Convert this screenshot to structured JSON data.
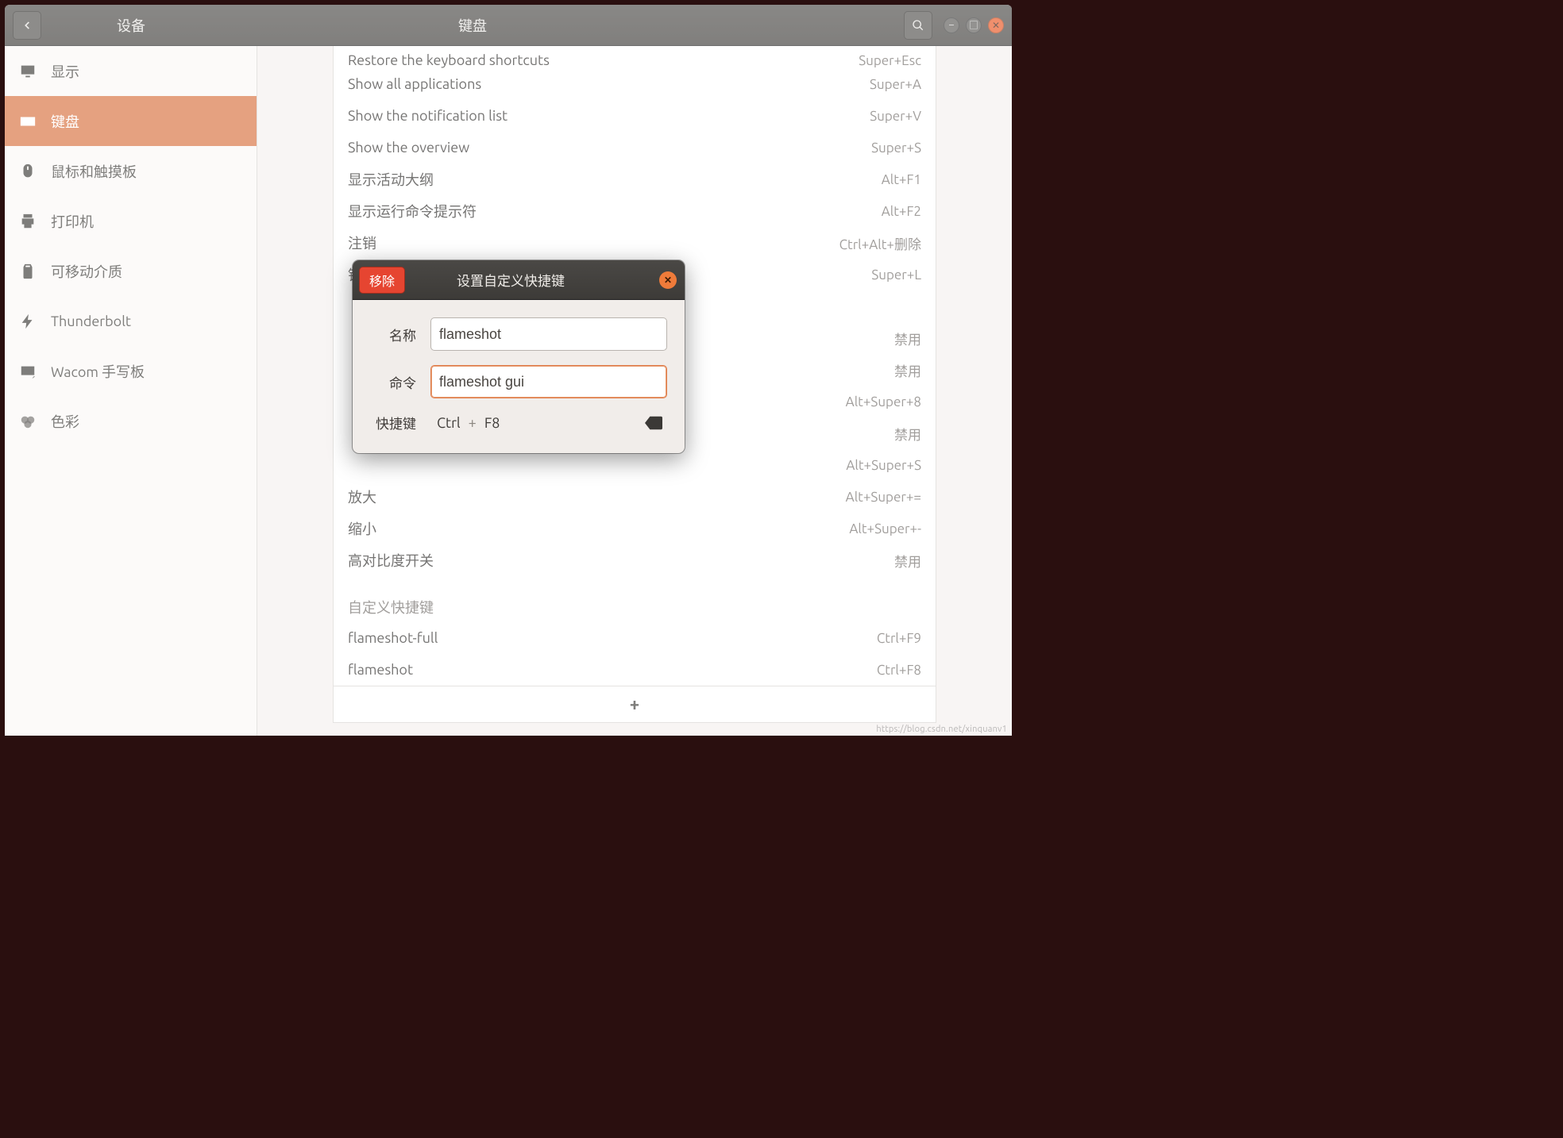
{
  "titlebar": {
    "left_title": "设备",
    "center_title": "键盘"
  },
  "sidebar": {
    "items": [
      {
        "label": "显示",
        "icon": "monitor-icon"
      },
      {
        "label": "键盘",
        "icon": "keyboard-icon",
        "active": true
      },
      {
        "label": "鼠标和触摸板",
        "icon": "mouse-icon"
      },
      {
        "label": "打印机",
        "icon": "printer-icon"
      },
      {
        "label": "可移动介质",
        "icon": "removable-icon"
      },
      {
        "label": "Thunderbolt",
        "icon": "thunderbolt-icon"
      },
      {
        "label": "Wacom 手写板",
        "icon": "tablet-icon"
      },
      {
        "label": "色彩",
        "icon": "color-icon"
      }
    ]
  },
  "shortcuts": {
    "rows": [
      {
        "label": "Restore the keyboard shortcuts",
        "keys": "Super+Esc",
        "partial": true
      },
      {
        "label": "Show all applications",
        "keys": "Super+A"
      },
      {
        "label": "Show the notification list",
        "keys": "Super+V"
      },
      {
        "label": "Show the overview",
        "keys": "Super+S"
      },
      {
        "label": "显示活动大纲",
        "keys": "Alt+F1"
      },
      {
        "label": "显示运行命令提示符",
        "keys": "Alt+F2"
      },
      {
        "label": "注销",
        "keys": "Ctrl+Alt+删除"
      },
      {
        "label": "锁定屏幕",
        "keys": "Super+L"
      },
      {
        "label": "",
        "keys": ""
      },
      {
        "label": "",
        "keys": "禁用"
      },
      {
        "label": "",
        "keys": "禁用"
      },
      {
        "label": "",
        "keys": "Alt+Super+8"
      },
      {
        "label": "",
        "keys": "禁用"
      },
      {
        "label": "",
        "keys": "Alt+Super+S"
      },
      {
        "label": "放大",
        "keys": "Alt+Super+="
      },
      {
        "label": "缩小",
        "keys": "Alt+Super+-"
      },
      {
        "label": "高对比度开关",
        "keys": "禁用"
      }
    ],
    "custom_section": "自定义快捷键",
    "custom": [
      {
        "label": "flameshot-full",
        "keys": "Ctrl+F9"
      },
      {
        "label": "flameshot",
        "keys": "Ctrl+F8"
      }
    ],
    "add_label": "+"
  },
  "dialog": {
    "remove": "移除",
    "title": "设置自定义快捷键",
    "name_label": "名称",
    "name_value": "flameshot",
    "command_label": "命令",
    "command_value": "flameshot gui",
    "shortcut_label": "快捷键",
    "shortcut_keys": [
      "Ctrl",
      "F8"
    ],
    "shortcut_joiner": "+"
  },
  "colors": {
    "accent": "#d86f3d",
    "danger": "#e64531"
  },
  "watermark": "https://blog.csdn.net/xinquanv1"
}
